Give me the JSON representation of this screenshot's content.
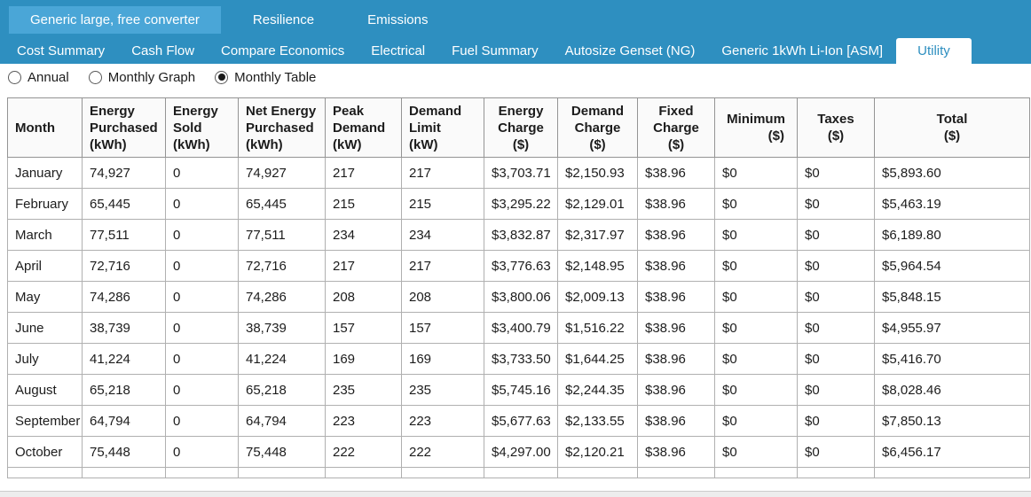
{
  "colors": {
    "topbar_blue": "#2e8fc0",
    "selected_primary_tab": "#4aa6d7",
    "selected_secondary_tab_text": "#2e8fc0",
    "header_background": "#fafafa"
  },
  "tabs_primary": {
    "items": [
      {
        "label": "Generic large, free converter",
        "selected": true
      },
      {
        "label": "Resilience",
        "selected": false
      },
      {
        "label": "Emissions",
        "selected": false
      }
    ]
  },
  "tabs_secondary": {
    "items": [
      {
        "label": "Cost Summary",
        "selected": false
      },
      {
        "label": "Cash Flow",
        "selected": false
      },
      {
        "label": "Compare Economics",
        "selected": false
      },
      {
        "label": "Electrical",
        "selected": false
      },
      {
        "label": "Fuel Summary",
        "selected": false
      },
      {
        "label": "Autosize Genset (NG)",
        "selected": false
      },
      {
        "label": "Generic 1kWh Li-Ion [ASM]",
        "selected": false
      },
      {
        "label": "Utility",
        "selected": true
      }
    ]
  },
  "view_options": {
    "radios": [
      {
        "label": "Annual",
        "selected": false
      },
      {
        "label": "Monthly Graph",
        "selected": false
      },
      {
        "label": "Monthly Table",
        "selected": true
      }
    ]
  },
  "table": {
    "columns": [
      {
        "key": "month",
        "label": "Month",
        "unit": "",
        "align": "left"
      },
      {
        "key": "energy-purchased",
        "label": "Energy Purchased",
        "unit": "(kWh)",
        "align": "left"
      },
      {
        "key": "energy-sold",
        "label": "Energy Sold",
        "unit": "(kWh)",
        "align": "left"
      },
      {
        "key": "net-energy-purchased",
        "label": "Net Energy Purchased",
        "unit": "(kWh)",
        "align": "left"
      },
      {
        "key": "peak-demand",
        "label": "Peak Demand",
        "unit": "(kW)",
        "align": "left"
      },
      {
        "key": "demand-limit",
        "label": "Demand Limit",
        "unit": "(kW)",
        "align": "left"
      },
      {
        "key": "energy-charge",
        "label": "Energy Charge",
        "unit": "($)",
        "align": "center"
      },
      {
        "key": "demand-charge",
        "label": "Demand Charge",
        "unit": "($)",
        "align": "center"
      },
      {
        "key": "fixed-charge",
        "label": "Fixed Charge",
        "unit": "($)",
        "align": "center"
      },
      {
        "key": "minimum",
        "label": "Minimum",
        "unit": "($)",
        "align": "center",
        "unit_align": "right"
      },
      {
        "key": "taxes",
        "label": "Taxes",
        "unit": "($)",
        "align": "center"
      },
      {
        "key": "total",
        "label": "Total",
        "unit": "($)",
        "align": "center"
      }
    ],
    "rows": [
      [
        "January",
        "74,927",
        "0",
        "74,927",
        "217",
        "217",
        "$3,703.71",
        "$2,150.93",
        "$38.96",
        "$0",
        "$0",
        "$5,893.60"
      ],
      [
        "February",
        "65,445",
        "0",
        "65,445",
        "215",
        "215",
        "$3,295.22",
        "$2,129.01",
        "$38.96",
        "$0",
        "$0",
        "$5,463.19"
      ],
      [
        "March",
        "77,511",
        "0",
        "77,511",
        "234",
        "234",
        "$3,832.87",
        "$2,317.97",
        "$38.96",
        "$0",
        "$0",
        "$6,189.80"
      ],
      [
        "April",
        "72,716",
        "0",
        "72,716",
        "217",
        "217",
        "$3,776.63",
        "$2,148.95",
        "$38.96",
        "$0",
        "$0",
        "$5,964.54"
      ],
      [
        "May",
        "74,286",
        "0",
        "74,286",
        "208",
        "208",
        "$3,800.06",
        "$2,009.13",
        "$38.96",
        "$0",
        "$0",
        "$5,848.15"
      ],
      [
        "June",
        "38,739",
        "0",
        "38,739",
        "157",
        "157",
        "$3,400.79",
        "$1,516.22",
        "$38.96",
        "$0",
        "$0",
        "$4,955.97"
      ],
      [
        "July",
        "41,224",
        "0",
        "41,224",
        "169",
        "169",
        "$3,733.50",
        "$1,644.25",
        "$38.96",
        "$0",
        "$0",
        "$5,416.70"
      ],
      [
        "August",
        "65,218",
        "0",
        "65,218",
        "235",
        "235",
        "$5,745.16",
        "$2,244.35",
        "$38.96",
        "$0",
        "$0",
        "$8,028.46"
      ],
      [
        "September",
        "64,794",
        "0",
        "64,794",
        "223",
        "223",
        "$5,677.63",
        "$2,133.55",
        "$38.96",
        "$0",
        "$0",
        "$7,850.13"
      ],
      [
        "October",
        "75,448",
        "0",
        "75,448",
        "222",
        "222",
        "$4,297.00",
        "$2,120.21",
        "$38.96",
        "$0",
        "$0",
        "$6,456.17"
      ]
    ]
  }
}
